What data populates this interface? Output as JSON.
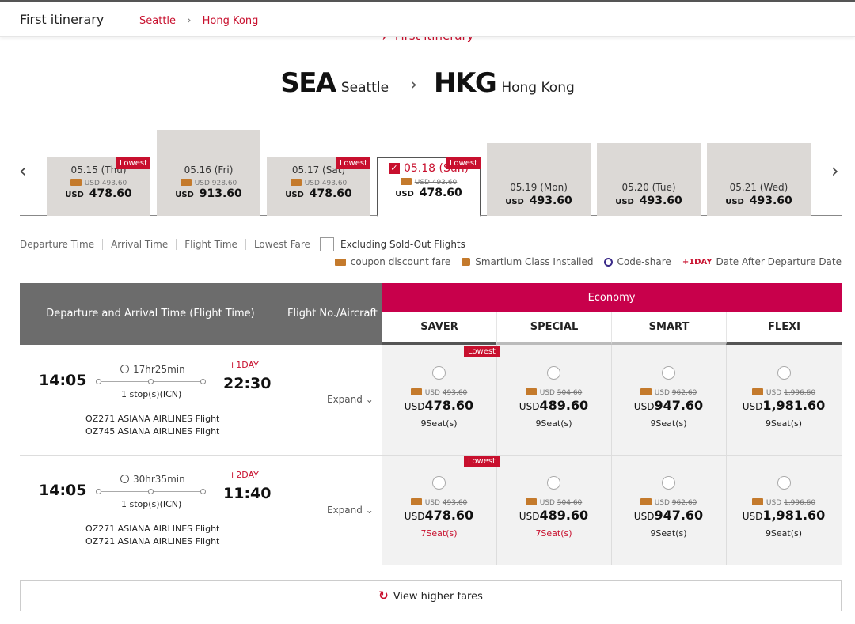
{
  "header": {
    "title": "First itinerary",
    "breadcrumb": [
      "Seattle",
      "Hong Kong"
    ]
  },
  "section_label": "First itinerary",
  "route": {
    "from_code": "SEA",
    "from_city": "Seattle",
    "to_code": "HKG",
    "to_city": "Hong Kong"
  },
  "dates": [
    {
      "label": "05.15 (Thu)",
      "old": "USD 493.60",
      "cur": "USD",
      "price": "478.60",
      "lowest": "Lowest"
    },
    {
      "label": "05.16 (Fri)",
      "old": "USD 928.60",
      "cur": "USD",
      "price": "913.60"
    },
    {
      "label": "05.17 (Sat)",
      "old": "USD 493.60",
      "cur": "USD",
      "price": "478.60",
      "lowest": "Lowest"
    },
    {
      "label": "05.18 (Sun)",
      "old": "USD 493.60",
      "cur": "USD",
      "price": "478.60",
      "lowest": "Lowest",
      "selected": true
    },
    {
      "label": "05.19 (Mon)",
      "cur": "USD",
      "price": "493.60"
    },
    {
      "label": "05.20 (Tue)",
      "cur": "USD",
      "price": "493.60"
    },
    {
      "label": "05.21 (Wed)",
      "cur": "USD",
      "price": "493.60"
    }
  ],
  "sort": [
    "Departure Time",
    "Arrival Time",
    "Flight Time",
    "Lowest Fare"
  ],
  "exclude_label": "Excluding Sold-Out Flights",
  "legend": {
    "coupon": "coupon discount fare",
    "smartium": "Smartium Class Installed",
    "codeshare": "Code-share",
    "plusday_tag": "+1DAY",
    "plusday_text": "Date After Departure Date"
  },
  "table": {
    "col1": "Departure and Arrival Time (Flight Time)",
    "col2": "Flight No./Aircraft",
    "cabin": "Economy",
    "fares": [
      "SAVER",
      "SPECIAL",
      "SMART",
      "FLEXI"
    ]
  },
  "flights": [
    {
      "dep": "14:05",
      "arr": "22:30",
      "plus": "+1DAY",
      "duration": "17hr25min",
      "stops": "1 stop(s)(ICN)",
      "legs": [
        "OZ271 ASIANA AIRLINES Flight",
        "OZ745 ASIANA AIRLINES Flight"
      ],
      "expand": "Expand",
      "fares": [
        {
          "old_cur": "USD",
          "old": "493.60",
          "cur": "USD",
          "price": "478.60",
          "seats": "9Seat(s)",
          "lowest": "Lowest"
        },
        {
          "old_cur": "USD",
          "old": "504.60",
          "cur": "USD",
          "price": "489.60",
          "seats": "9Seat(s)"
        },
        {
          "old_cur": "USD",
          "old": "962.60",
          "cur": "USD",
          "price": "947.60",
          "seats": "9Seat(s)"
        },
        {
          "old_cur": "USD",
          "old": "1,996.60",
          "cur": "USD",
          "price": "1,981.60",
          "seats": "9Seat(s)"
        }
      ]
    },
    {
      "dep": "14:05",
      "arr": "11:40",
      "plus": "+2DAY",
      "duration": "30hr35min",
      "stops": "1 stop(s)(ICN)",
      "legs": [
        "OZ271 ASIANA AIRLINES Flight",
        "OZ721 ASIANA AIRLINES Flight"
      ],
      "expand": "Expand",
      "fares": [
        {
          "old_cur": "USD",
          "old": "493.60",
          "cur": "USD",
          "price": "478.60",
          "seats": "7Seat(s)",
          "lowest": "Lowest",
          "seats_red": true
        },
        {
          "old_cur": "USD",
          "old": "504.60",
          "cur": "USD",
          "price": "489.60",
          "seats": "7Seat(s)",
          "seats_red": true
        },
        {
          "old_cur": "USD",
          "old": "962.60",
          "cur": "USD",
          "price": "947.60",
          "seats": "9Seat(s)"
        },
        {
          "old_cur": "USD",
          "old": "1,996.60",
          "cur": "USD",
          "price": "1,981.60",
          "seats": "9Seat(s)"
        }
      ]
    }
  ],
  "view_more": "View higher fares",
  "colors": {
    "accent": "#c8102e",
    "economy": "#c8004b",
    "header_gray": "#6c6c6c",
    "card_gray": "#dcd9d6"
  }
}
